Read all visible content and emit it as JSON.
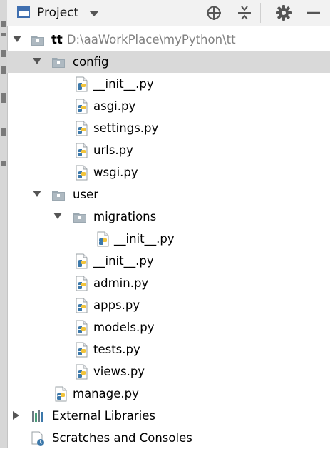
{
  "toolbar": {
    "title": "Project",
    "icons": [
      "project-window-icon",
      "chevron-down-icon",
      "crosshair-icon",
      "collapse-all-icon",
      "gear-icon",
      "minimize-icon"
    ]
  },
  "tree": {
    "root": {
      "name": "tt",
      "path": "D:\\aaWorkPlace\\myPython\\tt"
    },
    "config": {
      "name": "config",
      "files": [
        "__init__.py",
        "asgi.py",
        "settings.py",
        "urls.py",
        "wsgi.py"
      ]
    },
    "user": {
      "name": "user",
      "migrations": {
        "name": "migrations",
        "files": [
          "__init__.py"
        ]
      },
      "files": [
        "__init__.py",
        "admin.py",
        "apps.py",
        "models.py",
        "tests.py",
        "views.py"
      ]
    },
    "root_files": [
      "manage.py"
    ],
    "external_libraries": "External Libraries",
    "scratches": "Scratches and Consoles"
  },
  "colors": {
    "selected_row": "#d9d9d9",
    "folder": "#9aa7b0",
    "python_blue": "#3c78aa",
    "python_yellow": "#f2c43c"
  }
}
